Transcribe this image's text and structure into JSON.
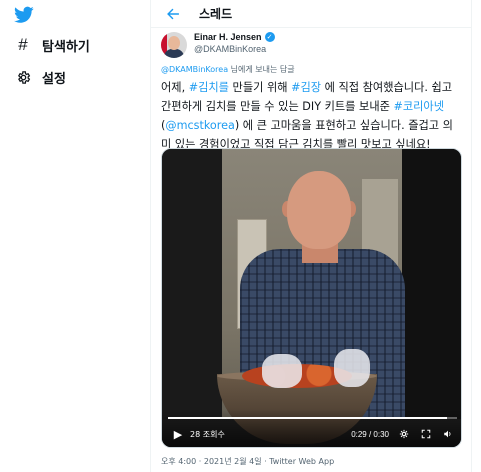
{
  "sidebar": {
    "items": [
      {
        "label": "탐색하기",
        "icon": "hashtag-icon"
      },
      {
        "label": "설정",
        "icon": "gear-icon"
      }
    ]
  },
  "header": {
    "title": "스레드"
  },
  "tweet": {
    "author": {
      "display_name": "Einar H. Jensen",
      "handle": "@DKAMBinKorea"
    },
    "reply_to": {
      "mention": "@DKAMBinKorea",
      "suffix": " 님에게 보내는 답글"
    },
    "text_segments": [
      {
        "t": "어제, ",
        "link": false
      },
      {
        "t": "#김치를",
        "link": true
      },
      {
        "t": " 만들기 위해 ",
        "link": false
      },
      {
        "t": "#김장",
        "link": true
      },
      {
        "t": " 에 직접 참여했습니다. 쉽고 간편하게 김치를 만들 수 있는 DIY 키트를 보내준 ",
        "link": false
      },
      {
        "t": "#코리아넷",
        "link": true
      },
      {
        "t": " (",
        "link": false
      },
      {
        "t": "@mcstkorea",
        "link": true
      },
      {
        "t": ") 에 큰 고마움을 표현하고 싶습니다. 즐겁고 의미 있는 경험이었고 직접 담근 김치를 빨리 맛보고 싶네요!",
        "link": false
      }
    ],
    "video": {
      "views": "28 조회수",
      "time": "0:29 / 0:30",
      "progress": 0.967
    },
    "meta": "오후 4:00 · 2021년 2월 4일 · Twitter Web App"
  },
  "colors": {
    "accent": "#1d9bf0",
    "text": "#0f1419",
    "secondary": "#536471"
  }
}
